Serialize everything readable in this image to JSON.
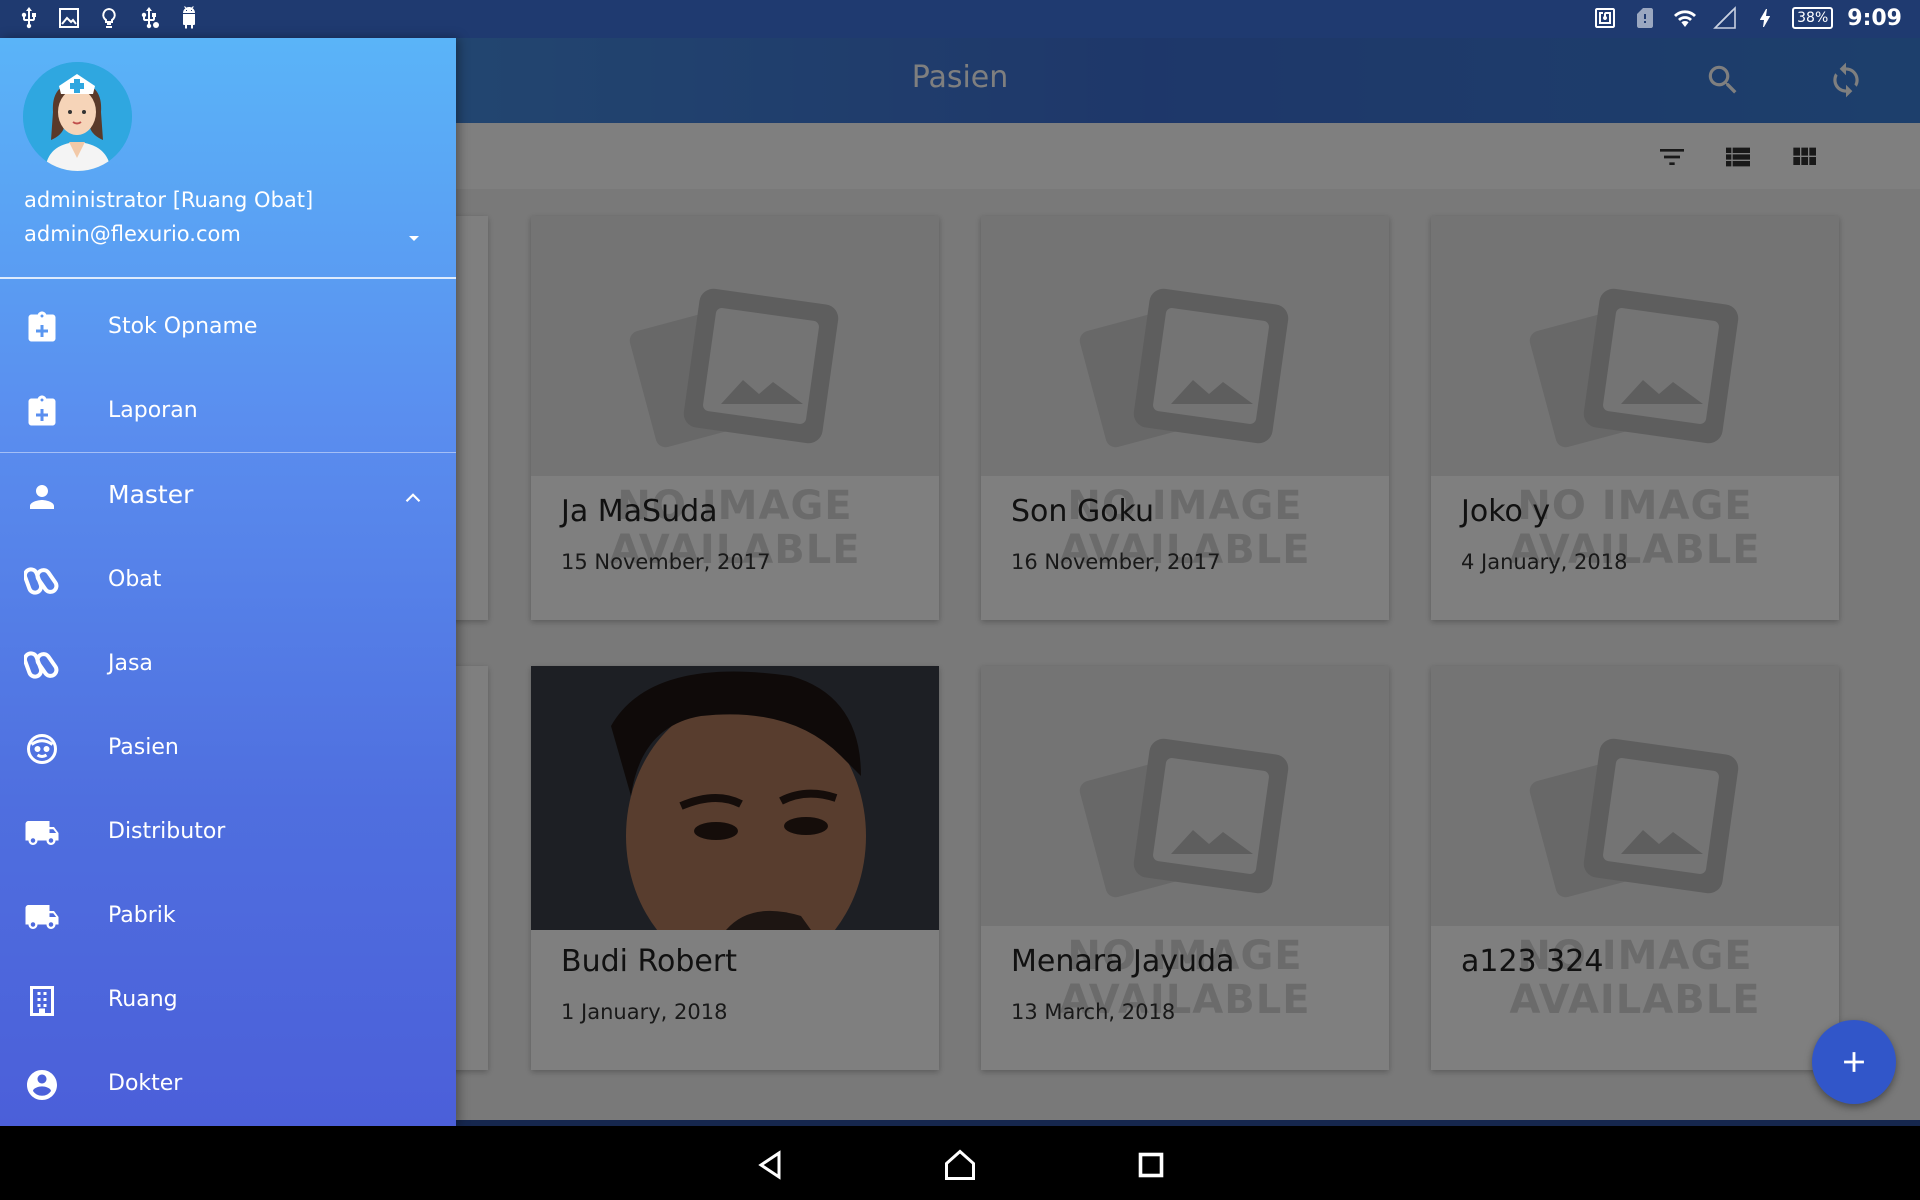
{
  "status_bar": {
    "left_icons": [
      "usb-icon",
      "image-icon",
      "bulb-icon",
      "usb-debug-icon",
      "android-icon"
    ],
    "right_icons": [
      "nfc-icon",
      "sim-alert-icon",
      "wifi-icon",
      "signal-icon",
      "charging-icon"
    ],
    "battery": "38%",
    "time": "9:09"
  },
  "app_bar": {
    "title": "Pasien",
    "actions": [
      "search-icon",
      "sync-icon"
    ]
  },
  "toolbar": {
    "buttons": [
      "filter-icon",
      "list-view-icon",
      "grid-view-icon"
    ]
  },
  "no_image_text": "NO IMAGE AVAILABLE",
  "patients": [
    {
      "name": "Ja MaSuda",
      "date": "15 November, 2017",
      "has_photo": false
    },
    {
      "name": "Son Goku",
      "date": "16 November, 2017",
      "has_photo": false
    },
    {
      "name": "Joko y",
      "date": "4 January, 2018",
      "has_photo": false
    },
    {
      "name": "Budi Robert",
      "date": "1 January, 2018",
      "has_photo": true
    },
    {
      "name": "Menara Jayuda",
      "date": "13 March, 2018",
      "has_photo": false
    },
    {
      "name": "a123 324",
      "date": "",
      "has_photo": false
    }
  ],
  "drawer": {
    "user_name": "administrator [Ruang Obat]",
    "user_email": "admin@flexurio.com",
    "items": [
      {
        "label": "Stok Opname",
        "icon": "clipboard-plus-icon"
      },
      {
        "label": "Laporan",
        "icon": "clipboard-plus-icon"
      },
      {
        "label": "Master",
        "icon": "person-icon"
      },
      {
        "label": "Obat",
        "icon": "pills-icon"
      },
      {
        "label": "Jasa",
        "icon": "pills-icon"
      },
      {
        "label": "Pasien",
        "icon": "face-icon"
      },
      {
        "label": "Distributor",
        "icon": "truck-icon"
      },
      {
        "label": "Pabrik",
        "icon": "truck-icon"
      },
      {
        "label": "Ruang",
        "icon": "building-icon"
      },
      {
        "label": "Dokter",
        "icon": "account-circle-icon"
      }
    ]
  },
  "nav_bar": [
    "back-icon",
    "home-icon",
    "recents-icon"
  ],
  "colors": {
    "primary": "#3d6fd4",
    "drawer_top": "#5ab4f8",
    "drawer_bottom": "#4b5fd9",
    "fab": "#3156c9"
  }
}
